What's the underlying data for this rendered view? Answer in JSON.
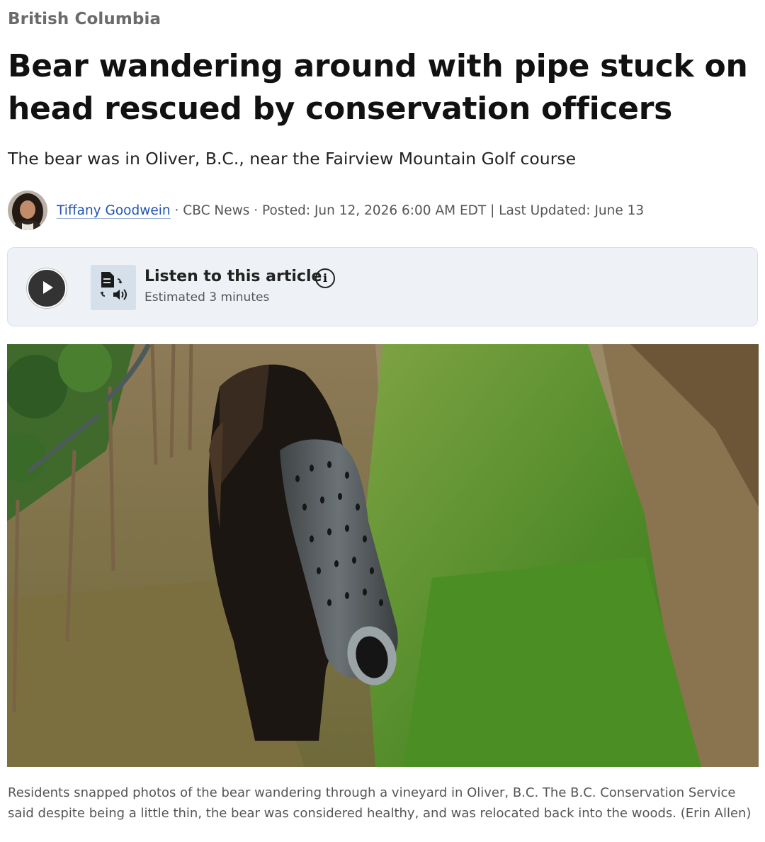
{
  "section": "British Columbia",
  "headline": "Bear wandering around with pipe stuck on head rescued by conservation officers",
  "dek": "The bear was in Oliver, B.C., near the Fairview Mountain Golf course",
  "byline": {
    "author": "Tiffany Goodwein",
    "source": "CBC News",
    "dates": "Posted: Jun 12, 2026 6:00 AM EDT | Last Updated: June 13",
    "separator": "·"
  },
  "audio": {
    "title": "Listen to this article",
    "duration": "Estimated 3 minutes",
    "play_icon": "play-icon",
    "tts_icon": "document-to-speech-icon",
    "info_icon": "info-icon",
    "info_glyph": "i"
  },
  "photo": {
    "caption": "Residents snapped photos of the bear wandering through a vineyard in Oliver, B.C. The B.C. Conservation Service said despite being a little thin, the bear was considered healthy, and was relocated back into the woods. (Erin Allen)"
  },
  "colors": {
    "link": "#1f53b3",
    "audio_panel": "#eef2f6",
    "section": "#6b6b6b"
  }
}
